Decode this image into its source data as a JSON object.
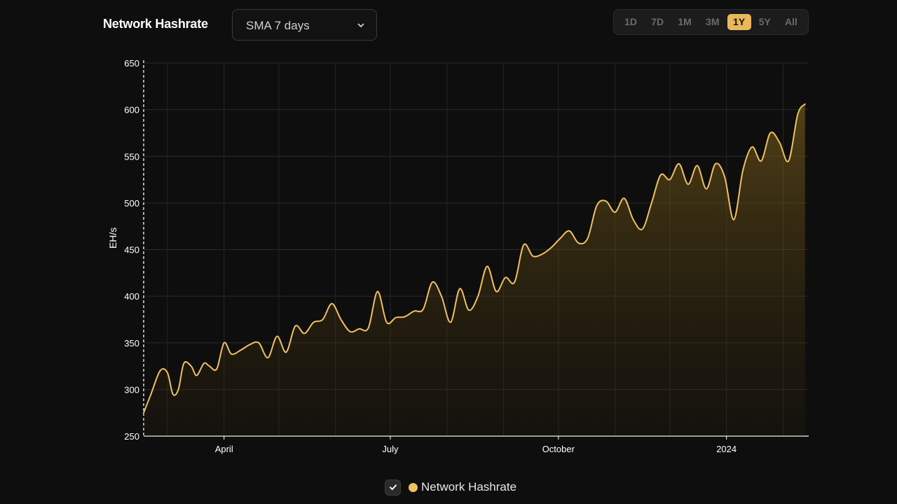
{
  "header": {
    "title": "Network Hashrate",
    "average_select": {
      "value": "SMA 7 days",
      "icon": "chevron-down-icon"
    }
  },
  "range_buttons": [
    {
      "label": "1D",
      "active": false
    },
    {
      "label": "7D",
      "active": false
    },
    {
      "label": "1M",
      "active": false
    },
    {
      "label": "3M",
      "active": false
    },
    {
      "label": "1Y",
      "active": true
    },
    {
      "label": "5Y",
      "active": false
    },
    {
      "label": "All",
      "active": false
    }
  ],
  "legend": {
    "checked": true,
    "icon": "check-icon",
    "label": "Network Hashrate",
    "color": "#f0c060"
  },
  "chart_data": {
    "type": "area",
    "title": "",
    "xlabel": "",
    "ylabel": "EH/s",
    "ylim": [
      250,
      650
    ],
    "yticks": [
      250,
      300,
      350,
      400,
      450,
      500,
      550,
      600,
      650
    ],
    "xticks": [
      {
        "label": "April",
        "date": "2023-04-01"
      },
      {
        "label": "July",
        "date": "2023-07-01"
      },
      {
        "label": "October",
        "date": "2023-10-01"
      },
      {
        "label": "2024",
        "date": "2024-01-01"
      }
    ],
    "xlim": [
      "2023-02-16",
      "2024-02-15"
    ],
    "grid": true,
    "legend_position": "bottom-center",
    "color": "#f0c060",
    "series": [
      {
        "name": "Network Hashrate",
        "x": [
          "2023-02-16",
          "2023-02-20",
          "2023-02-25",
          "2023-03-01",
          "2023-03-04",
          "2023-03-07",
          "2023-03-10",
          "2023-03-14",
          "2023-03-17",
          "2023-03-21",
          "2023-03-24",
          "2023-03-28",
          "2023-04-01",
          "2023-04-05",
          "2023-04-10",
          "2023-04-15",
          "2023-04-20",
          "2023-04-25",
          "2023-04-30",
          "2023-05-05",
          "2023-05-10",
          "2023-05-15",
          "2023-05-20",
          "2023-05-25",
          "2023-05-30",
          "2023-06-04",
          "2023-06-09",
          "2023-06-14",
          "2023-06-19",
          "2023-06-24",
          "2023-06-29",
          "2023-07-04",
          "2023-07-09",
          "2023-07-14",
          "2023-07-19",
          "2023-07-24",
          "2023-07-29",
          "2023-08-03",
          "2023-08-08",
          "2023-08-13",
          "2023-08-18",
          "2023-08-23",
          "2023-08-28",
          "2023-09-02",
          "2023-09-07",
          "2023-09-12",
          "2023-09-17",
          "2023-09-22",
          "2023-09-27",
          "2023-10-02",
          "2023-10-07",
          "2023-10-12",
          "2023-10-17",
          "2023-10-22",
          "2023-10-27",
          "2023-11-01",
          "2023-11-06",
          "2023-11-11",
          "2023-11-16",
          "2023-11-21",
          "2023-11-26",
          "2023-12-01",
          "2023-12-06",
          "2023-12-11",
          "2023-12-16",
          "2023-12-21",
          "2023-12-26",
          "2023-12-31",
          "2024-01-05",
          "2024-01-10",
          "2024-01-15",
          "2024-01-20",
          "2024-01-25",
          "2024-01-30",
          "2024-02-04",
          "2024-02-09",
          "2024-02-13"
        ],
        "values": [
          275,
          295,
          320,
          318,
          295,
          300,
          328,
          325,
          315,
          328,
          325,
          322,
          350,
          338,
          342,
          348,
          350,
          334,
          357,
          340,
          368,
          360,
          372,
          375,
          392,
          375,
          362,
          365,
          366,
          405,
          372,
          377,
          378,
          384,
          386,
          415,
          400,
          372,
          408,
          385,
          400,
          432,
          405,
          420,
          415,
          455,
          443,
          445,
          452,
          462,
          470,
          457,
          462,
          497,
          502,
          490,
          505,
          482,
          472,
          500,
          530,
          525,
          542,
          520,
          540,
          515,
          542,
          528,
          482,
          535,
          560,
          545,
          575,
          565,
          545,
          595,
          606
        ]
      }
    ]
  }
}
